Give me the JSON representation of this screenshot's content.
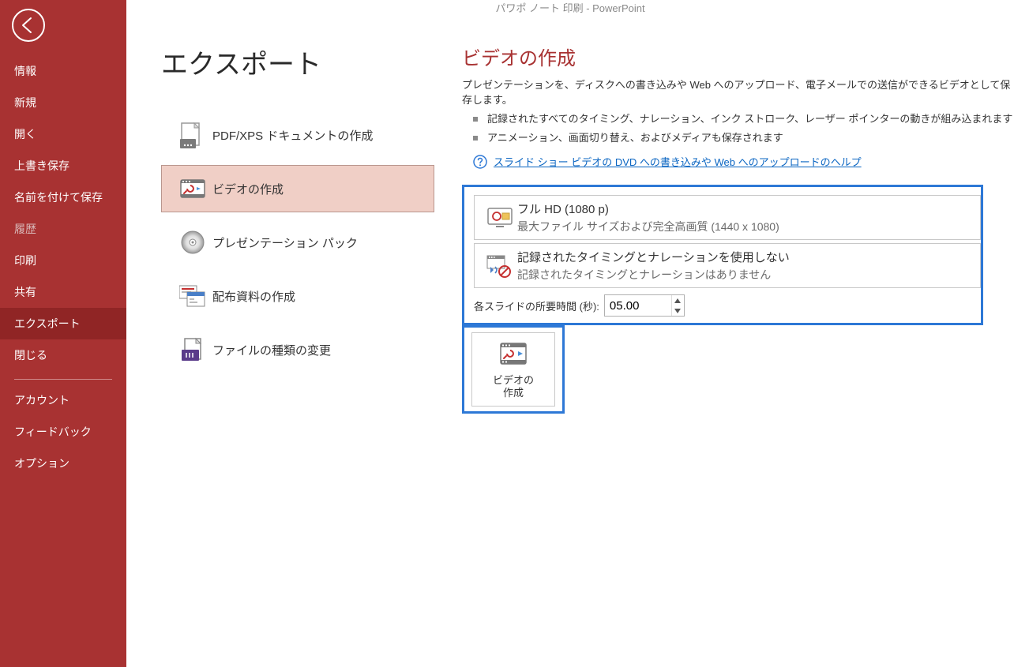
{
  "colors": {
    "sidebar_bg": "#a83232",
    "accent": "#a83232",
    "highlight_border": "#2d78d6"
  },
  "titlebar": "パワポ ノート 印刷  -  PowerPoint",
  "sidebar": {
    "items": [
      {
        "label": "情報",
        "disabled": false
      },
      {
        "label": "新規",
        "disabled": false
      },
      {
        "label": "開く",
        "disabled": false
      },
      {
        "label": "上書き保存",
        "disabled": false
      },
      {
        "label": "名前を付けて保存",
        "disabled": false
      },
      {
        "label": "履歴",
        "disabled": true
      },
      {
        "label": "印刷",
        "disabled": false
      },
      {
        "label": "共有",
        "disabled": false
      },
      {
        "label": "エクスポート",
        "disabled": false,
        "selected": true
      },
      {
        "label": "閉じる",
        "disabled": false
      }
    ],
    "bottom_items": [
      {
        "label": "アカウント"
      },
      {
        "label": "フィードバック"
      },
      {
        "label": "オプション"
      }
    ]
  },
  "page_title": "エクスポート",
  "export_options": [
    {
      "label": "PDF/XPS ドキュメントの作成",
      "icon": "pdf-icon"
    },
    {
      "label": "ビデオの作成",
      "icon": "video-icon",
      "selected": true
    },
    {
      "label": "プレゼンテーション パック",
      "icon": "cd-icon"
    },
    {
      "label": "配布資料の作成",
      "icon": "handout-icon"
    },
    {
      "label": "ファイルの種類の変更",
      "icon": "file-type-icon"
    }
  ],
  "detail": {
    "title": "ビデオの作成",
    "description": "プレゼンテーションを、ディスクへの書き込みや Web へのアップロード、電子メールでの送信ができるビデオとして保存します。",
    "bullets": [
      "記録されたすべてのタイミング、ナレーション、インク ストローク、レーザー ポインターの動きが組み込まれます",
      "アニメーション、画面切り替え、およびメディアも保存されます"
    ],
    "help_link": "スライド ショー ビデオの DVD への書き込みや Web へのアップロードのヘルプ",
    "quality": {
      "title": "フル HD (1080 p)",
      "subtitle": "最大ファイル サイズおよび完全高画質 (1440 x 1080)"
    },
    "timing_opt": {
      "title": "記録されたタイミングとナレーションを使用しない",
      "subtitle": "記録されたタイミングとナレーションはありません"
    },
    "per_slide_time_label": "各スライドの所要時間 (秒):",
    "per_slide_time_value": "05.00",
    "create_button": "ビデオの\n作成",
    "create_button_line1": "ビデオの",
    "create_button_line2": "作成"
  }
}
